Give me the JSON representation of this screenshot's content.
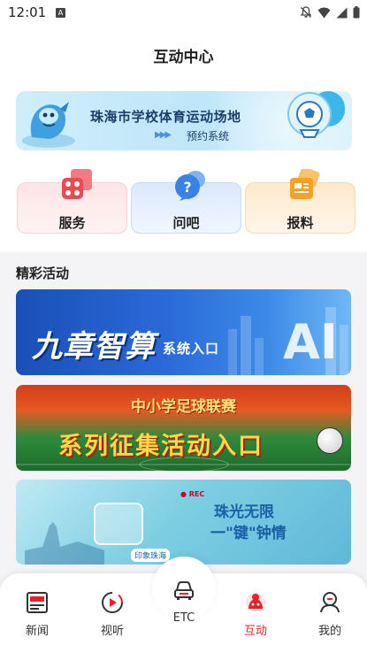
{
  "status_bar": {
    "time": "12:01",
    "notification_icon": "a-box-icon",
    "icons": [
      "mute-icon",
      "wifi-icon",
      "signal-icon",
      "battery-icon"
    ]
  },
  "header": {
    "title": "互动中心"
  },
  "booking_banner": {
    "title": "珠海市学校体育运动场地",
    "subtitle": "预约系统",
    "arrows": "▶▶▶"
  },
  "quick_links": [
    {
      "label": "服务",
      "icon": "service-grid-icon",
      "color": "#e84b52"
    },
    {
      "label": "问吧",
      "icon": "question-bubble-icon",
      "color": "#3b82e6"
    },
    {
      "label": "报料",
      "icon": "report-card-icon",
      "color": "#f5a12a"
    }
  ],
  "activities": {
    "title": "精彩活动",
    "banners": [
      {
        "main": "九章智算",
        "sub": "系统入口",
        "mark": "AI"
      },
      {
        "top": "中小学足球联赛",
        "main": "系列征集活动入口"
      },
      {
        "rec": "● REC",
        "title": "珠光无限",
        "subtitle": "一\"键\"钟情",
        "tag": "印象珠海"
      }
    ]
  },
  "tab_bar": {
    "accent": "#e8202a",
    "items": [
      {
        "label": "新闻",
        "icon": "news-icon"
      },
      {
        "label": "视听",
        "icon": "play-icon"
      },
      {
        "label": "ETC",
        "icon": "car-icon"
      },
      {
        "label": "互动",
        "icon": "interact-icon",
        "active": true
      },
      {
        "label": "我的",
        "icon": "profile-icon"
      }
    ]
  }
}
